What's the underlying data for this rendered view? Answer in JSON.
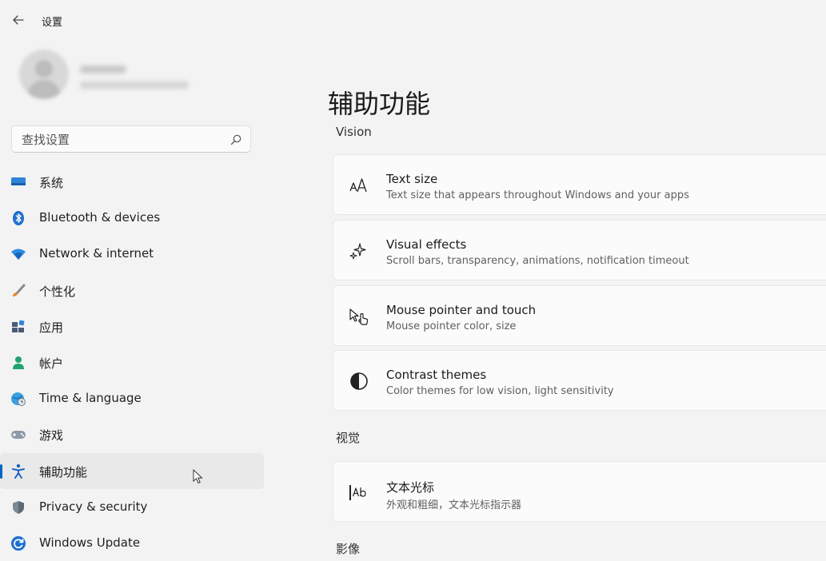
{
  "window": {
    "title": "设置"
  },
  "profile": {
    "name": "",
    "email": ""
  },
  "search": {
    "placeholder": "查找设置"
  },
  "sidebar": {
    "items": [
      {
        "label": "系统",
        "icon": "monitor-icon"
      },
      {
        "label": "Bluetooth & devices",
        "icon": "bluetooth-icon"
      },
      {
        "label": "Network & internet",
        "icon": "wifi-icon"
      },
      {
        "label": "个性化",
        "icon": "brush-icon"
      },
      {
        "label": "应用",
        "icon": "apps-icon"
      },
      {
        "label": "帐户",
        "icon": "person-icon"
      },
      {
        "label": "Time & language",
        "icon": "globe-clock-icon"
      },
      {
        "label": "游戏",
        "icon": "gamepad-icon"
      },
      {
        "label": "辅助功能",
        "icon": "accessibility-icon",
        "selected": true
      },
      {
        "label": "Privacy & security",
        "icon": "shield-icon"
      },
      {
        "label": "Windows Update",
        "icon": "update-icon"
      }
    ]
  },
  "main": {
    "title": "辅助功能",
    "sections": [
      {
        "heading": "Vision",
        "cards": [
          {
            "title": "Text size",
            "subtitle": "Text size that appears throughout Windows and your apps",
            "icon": "text-size-icon"
          },
          {
            "title": "Visual effects",
            "subtitle": "Scroll bars, transparency, animations, notification timeout",
            "icon": "sparkle-icon"
          },
          {
            "title": "Mouse pointer and touch",
            "subtitle": "Mouse pointer color, size",
            "icon": "pointer-touch-icon"
          },
          {
            "title": "Contrast themes",
            "subtitle": "Color themes for low vision, light sensitivity",
            "icon": "contrast-icon"
          }
        ]
      },
      {
        "heading": "视觉",
        "cards": [
          {
            "title": "文本光标",
            "subtitle": "外观和粗细，文本光标指示器",
            "icon": "text-cursor-icon"
          }
        ]
      },
      {
        "heading": "影像",
        "cards": []
      }
    ]
  },
  "colors": {
    "accent": "#0067c0",
    "background": "#f3f3f3",
    "card": "#fbfbfb"
  }
}
